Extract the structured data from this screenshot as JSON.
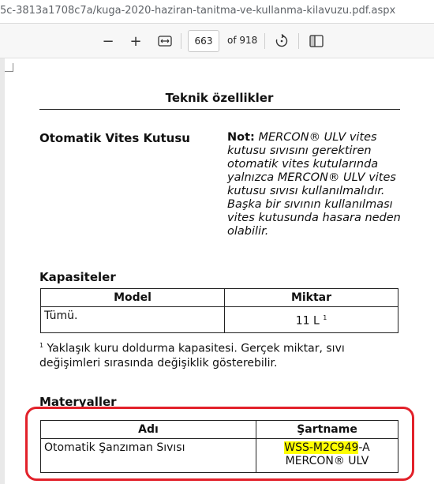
{
  "address_bar": {
    "url": "5c-3813a1708c7a/kuga-2020-haziran-tanitma-ve-kullanma-kilavuzu.pdf.aspx"
  },
  "toolbar": {
    "zoom_out": "−",
    "zoom_in": "+",
    "current_page": "663",
    "total_pages": "of 918"
  },
  "document": {
    "title": "Teknik özellikler",
    "gearbox_heading": "Otomatik Vites Kutusu",
    "note_label": "Not:",
    "note_text": "MERCON® ULV vites kutusu sıvısını gerektiren otomatik vites kutularında yalnızca MERCON® ULV vites kutusu sıvısı kullanılmalıdır.  Başka bir sıvının kullanılması vites kutusunda hasara neden olabilir.",
    "capacities_heading": "Kapasiteler",
    "capacities_table": {
      "headers": [
        "Model",
        "Miktar"
      ],
      "rows": [
        {
          "model": "Tümü.",
          "amount": "11 L",
          "footnote_ref": "1"
        }
      ]
    },
    "footnote_number": "1",
    "footnote_text": "Yaklaşık kuru doldurma kapasitesi.  Gerçek miktar, sıvı değişimleri sırasında değişiklik gösterebilir.",
    "materials_heading": "Materyaller",
    "materials_table": {
      "headers": [
        "Adı",
        "Şartname"
      ],
      "rows": [
        {
          "name": "Otomatik Şanzıman Sıvısı",
          "spec_highlight": "WSS-M2C949",
          "spec_rest": "-A",
          "spec_line2": "MERCON® ULV"
        }
      ]
    }
  },
  "colors": {
    "highlight": "#ffff00",
    "annotation_box": "#e2212a"
  }
}
